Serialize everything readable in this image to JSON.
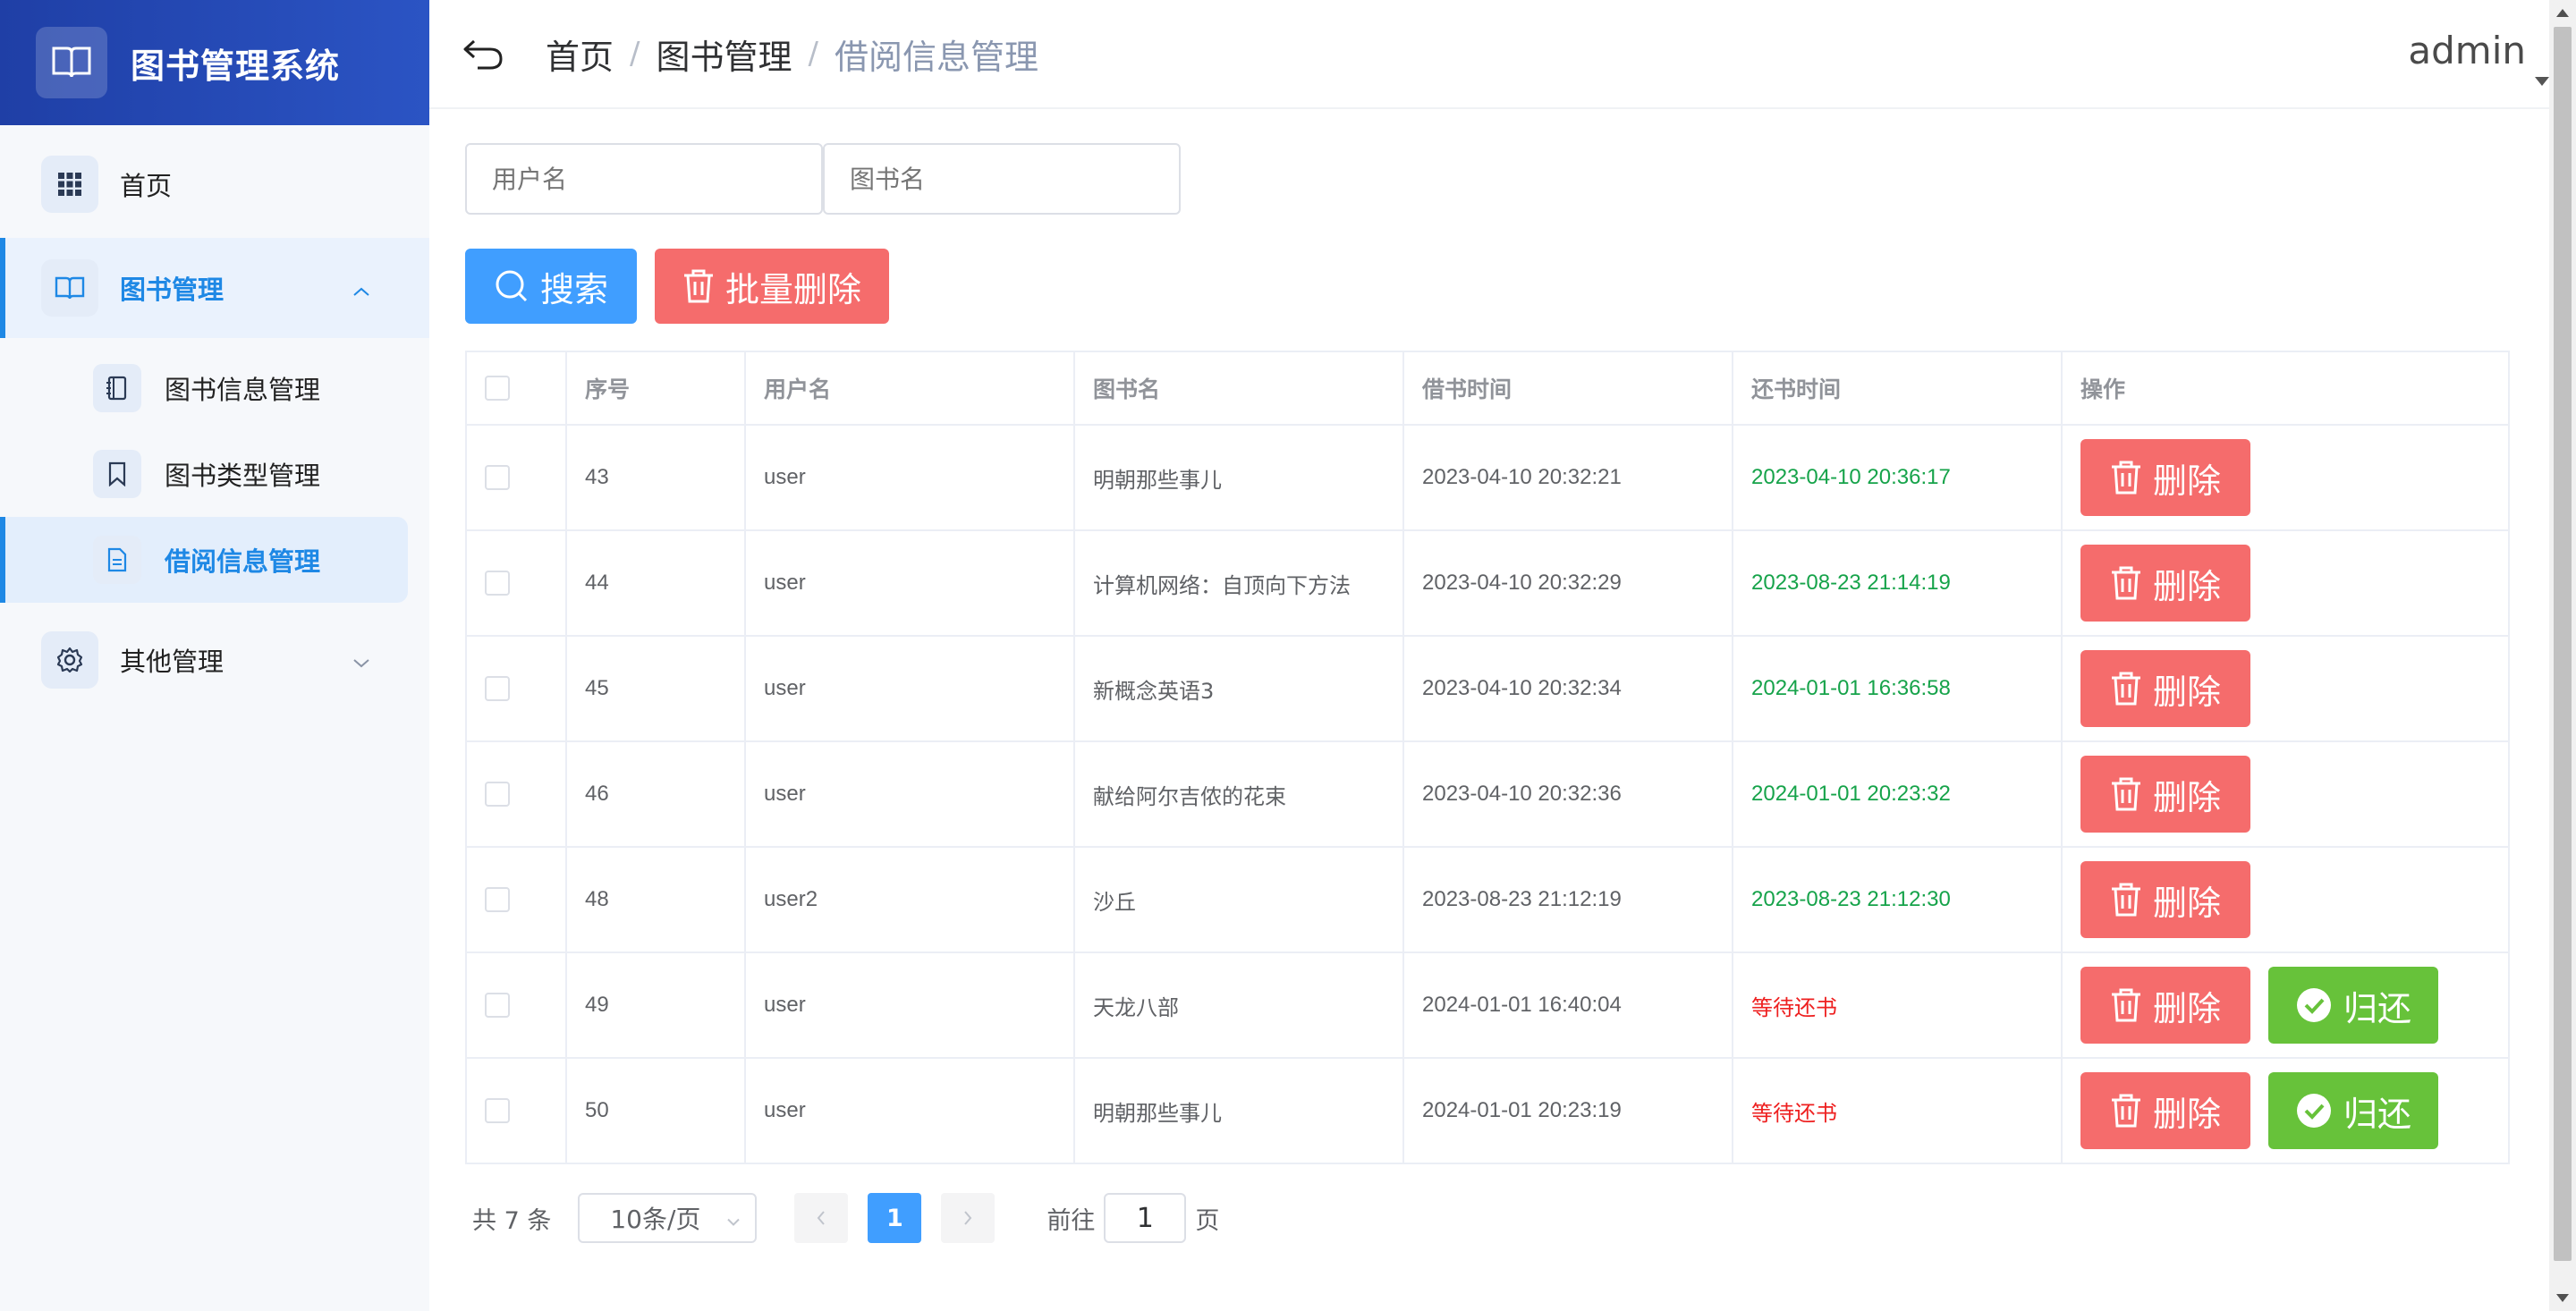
{
  "app": {
    "title": "图书管理系统"
  },
  "sidebar": {
    "items": [
      {
        "label": "首页"
      },
      {
        "label": "图书管理",
        "children": [
          {
            "label": "图书信息管理"
          },
          {
            "label": "图书类型管理"
          },
          {
            "label": "借阅信息管理"
          }
        ]
      },
      {
        "label": "其他管理"
      }
    ]
  },
  "header": {
    "breadcrumb": [
      "首页",
      "图书管理",
      "借阅信息管理"
    ],
    "separator": "/",
    "user": "admin"
  },
  "search": {
    "username_placeholder": "用户名",
    "bookname_placeholder": "图书名",
    "search_label": "搜索",
    "batch_delete_label": "批量删除"
  },
  "table": {
    "columns": [
      "序号",
      "用户名",
      "图书名",
      "借书时间",
      "还书时间",
      "操作"
    ],
    "rows": [
      {
        "id": "43",
        "user": "user",
        "book": "明朝那些事儿",
        "borrow": "2023-04-10 20:32:21",
        "return": "2023-04-10 20:36:17",
        "returned": true
      },
      {
        "id": "44",
        "user": "user",
        "book": "计算机网络：自顶向下方法",
        "borrow": "2023-04-10 20:32:29",
        "return": "2023-08-23 21:14:19",
        "returned": true
      },
      {
        "id": "45",
        "user": "user",
        "book": "新概念英语3",
        "borrow": "2023-04-10 20:32:34",
        "return": "2024-01-01 16:36:58",
        "returned": true
      },
      {
        "id": "46",
        "user": "user",
        "book": "献给阿尔吉侬的花束",
        "borrow": "2023-04-10 20:32:36",
        "return": "2024-01-01 20:23:32",
        "returned": true
      },
      {
        "id": "48",
        "user": "user2",
        "book": "沙丘",
        "borrow": "2023-08-23 21:12:19",
        "return": "2023-08-23 21:12:30",
        "returned": true
      },
      {
        "id": "49",
        "user": "user",
        "book": "天龙八部",
        "borrow": "2024-01-01 16:40:04",
        "return": "等待还书",
        "returned": false
      },
      {
        "id": "50",
        "user": "user",
        "book": "明朝那些事儿",
        "borrow": "2024-01-01 20:23:19",
        "return": "等待还书",
        "returned": false
      }
    ],
    "delete_label": "删除",
    "return_label": "归还"
  },
  "pagination": {
    "total_text": "共 7 条",
    "page_size": "10条/页",
    "current_page": "1",
    "goto_prefix": "前往",
    "goto_value": "1",
    "goto_suffix": "页"
  },
  "colors": {
    "primary": "#409eff",
    "danger": "#f56c6c",
    "success": "#67c23a",
    "header_gradient": "#1f3fa6",
    "returned_text": "#16a34a",
    "pending_text": "#ee2020"
  }
}
